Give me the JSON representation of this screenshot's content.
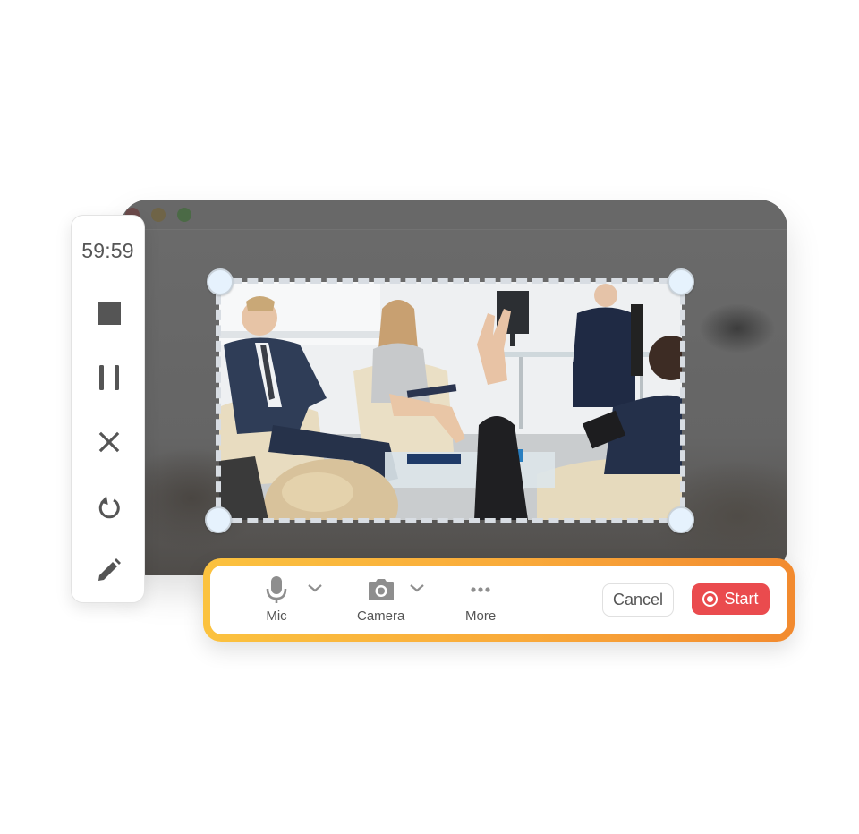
{
  "window": {
    "title_bar_buttons": [
      "close",
      "minimize",
      "maximize"
    ]
  },
  "selection": {
    "image_description": "Business meeting in an office; a person in the foreground raises a hand",
    "handles": [
      "top-left",
      "top-right",
      "bottom-left",
      "bottom-right"
    ],
    "border_color": "#d8dde3",
    "handle_color": "#e6f2fd"
  },
  "recording_panel": {
    "timer": "59:59",
    "buttons": [
      {
        "name": "stop",
        "icon": "stop-icon"
      },
      {
        "name": "pause",
        "icon": "pause-icon"
      },
      {
        "name": "discard",
        "icon": "close-icon"
      },
      {
        "name": "restart",
        "icon": "restart-icon"
      },
      {
        "name": "annotate",
        "icon": "pencil-icon"
      }
    ]
  },
  "toolbar": {
    "mic_label": "Mic",
    "camera_label": "Camera",
    "more_label": "More",
    "cancel_label": "Cancel",
    "start_label": "Start",
    "accent_gradient": [
      "#fbc23f",
      "#f28a2f"
    ],
    "start_color": "#ea4b4e"
  }
}
